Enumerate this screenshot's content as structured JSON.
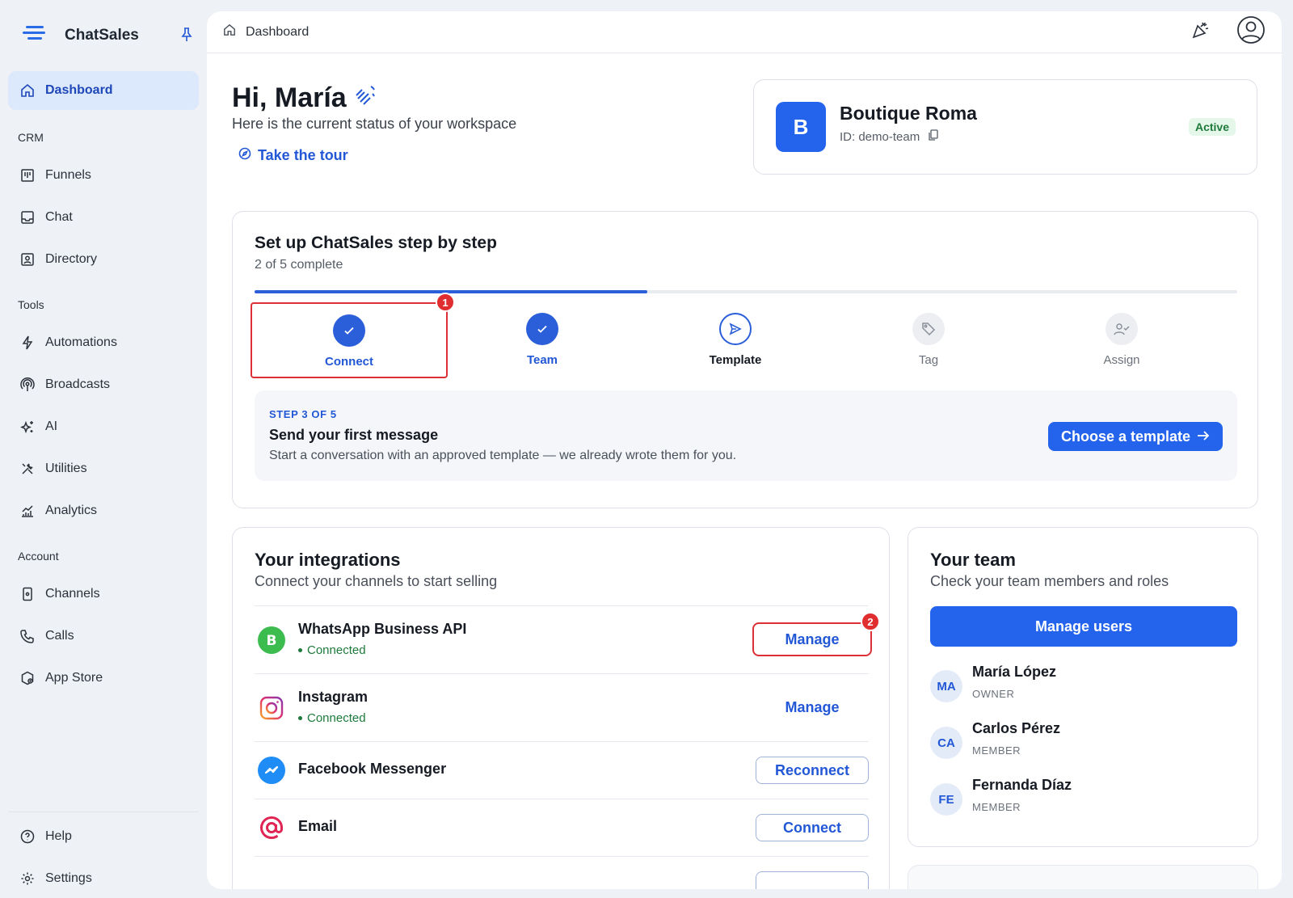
{
  "brand": {
    "name": "ChatSales"
  },
  "sidebar": {
    "dashboard": "Dashboard",
    "sections": {
      "crm": "CRM",
      "tools": "Tools",
      "account": "Account"
    },
    "crm_items": [
      "Funnels",
      "Chat",
      "Directory"
    ],
    "tools_items": [
      "Automations",
      "Broadcasts",
      "AI",
      "Utilities",
      "Analytics"
    ],
    "account_items": [
      "Channels",
      "Calls",
      "App Store"
    ],
    "footer_items": [
      "Help",
      "Settings"
    ]
  },
  "topbar": {
    "breadcrumb": "Dashboard"
  },
  "greeting": {
    "title": "Hi, María",
    "subtitle": "Here is the current status of your workspace",
    "tour": "Take the tour"
  },
  "workspace": {
    "initial": "B",
    "name": "Boutique Roma",
    "id": "ID: demo-team",
    "status": "Active",
    "status_color": "#1d7a3b"
  },
  "setup": {
    "title": "Set up ChatSales step by step",
    "progress_text": "2 of 5 complete",
    "progress_fraction": 0.4,
    "steps": [
      {
        "label": "Connect",
        "state": "done"
      },
      {
        "label": "Team",
        "state": "done"
      },
      {
        "label": "Template",
        "state": "current"
      },
      {
        "label": "Tag",
        "state": "todo"
      },
      {
        "label": "Assign",
        "state": "todo"
      }
    ],
    "panel": {
      "kicker": "STEP 3 OF 5",
      "title": "Send your first message",
      "description": "Start a conversation with an approved template — we already wrote them for you.",
      "cta": "Choose a template"
    }
  },
  "markers": {
    "first": "1",
    "second": "2"
  },
  "integrations": {
    "title": "Your integrations",
    "subtitle": "Connect your channels to start selling",
    "rows": [
      {
        "name": "WhatsApp Business API",
        "status": "Connected",
        "action": "Manage",
        "icon": "whatsapp-icon"
      },
      {
        "name": "Instagram",
        "status": "Connected",
        "action": "Manage",
        "icon": "instagram-icon"
      },
      {
        "name": "Facebook Messenger",
        "status": "",
        "action": "Reconnect",
        "icon": "messenger-icon"
      },
      {
        "name": "Email",
        "status": "",
        "action": "Connect",
        "icon": "email-icon"
      }
    ]
  },
  "team": {
    "title": "Your team",
    "subtitle": "Check your team members and roles",
    "manage": "Manage users",
    "members": [
      {
        "initials": "MA",
        "name": "María López",
        "role": "OWNER"
      },
      {
        "initials": "CA",
        "name": "Carlos Pérez",
        "role": "MEMBER"
      },
      {
        "initials": "FE",
        "name": "Fernanda Díaz",
        "role": "MEMBER"
      }
    ]
  },
  "colors": {
    "accent": "#2463eb",
    "highlight": "#dc2f36",
    "connected": "#1d7a3b"
  }
}
